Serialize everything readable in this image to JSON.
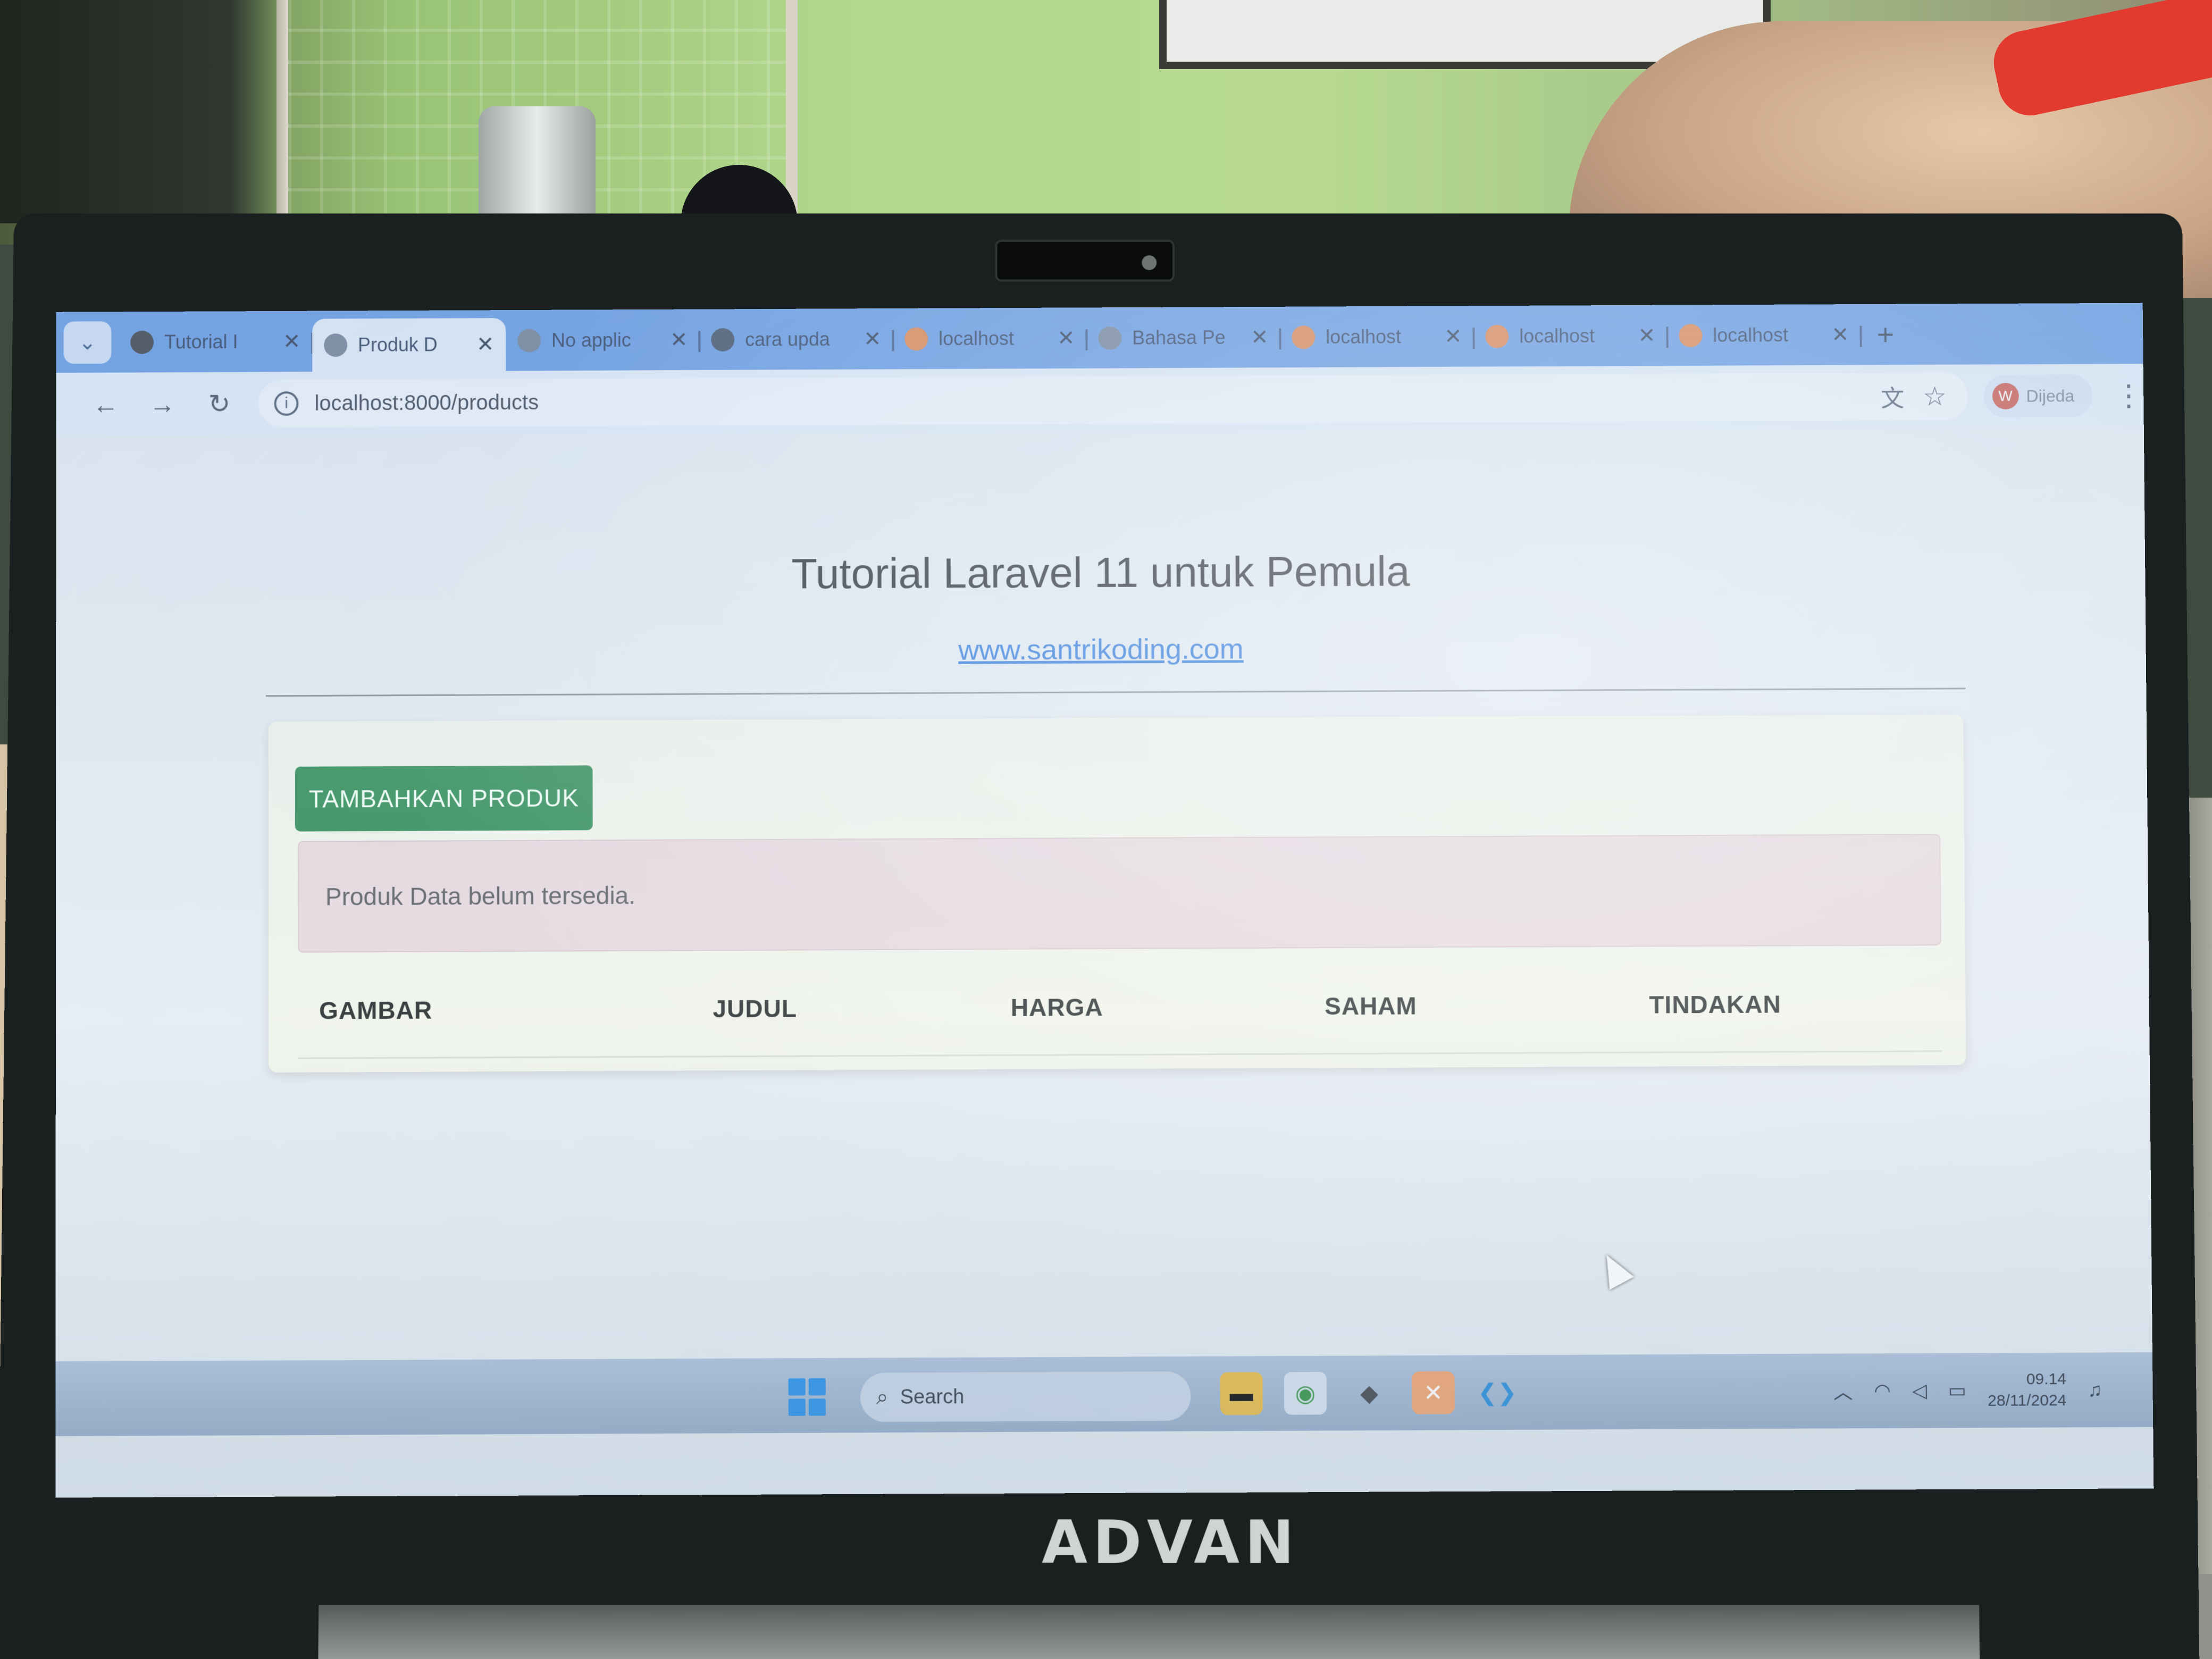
{
  "browser": {
    "tabs": [
      {
        "title": "Tutorial I",
        "icon": "github-icon",
        "active": false
      },
      {
        "title": "Produk D",
        "icon": "globe-icon",
        "active": true
      },
      {
        "title": "No applic",
        "icon": "globe-icon",
        "active": false
      },
      {
        "title": "cara upda",
        "icon": "avatar-icon",
        "active": false
      },
      {
        "title": "localhost",
        "icon": "phpmyadmin-icon",
        "active": false
      },
      {
        "title": "Bahasa Pe",
        "icon": "globe-icon",
        "active": false
      },
      {
        "title": "localhost",
        "icon": "phpmyadmin-icon",
        "active": false
      },
      {
        "title": "localhost",
        "icon": "phpmyadmin-icon",
        "active": false
      },
      {
        "title": "localhost",
        "icon": "phpmyadmin-icon",
        "active": false
      }
    ],
    "new_tab_symbol": "+",
    "close_symbol": "✕",
    "address": "localhost:8000/products",
    "profile_initial": "W",
    "profile_name": "Dijeda"
  },
  "page": {
    "title": "Tutorial Laravel 11 untuk Pemula",
    "link": "www.santrikoding.com",
    "add_button": "TAMBAHKAN PRODUK",
    "alert": "Produk Data belum tersedia.",
    "table_headers": [
      "GAMBAR",
      "JUDUL",
      "HARGA",
      "SAHAM",
      "TINDAKAN"
    ]
  },
  "taskbar": {
    "search_label": "Search",
    "time": "09.14",
    "date": "28/11/2024"
  },
  "device": {
    "brand": "ADVAN"
  },
  "colors": {
    "tabstrip": "#4f8be0",
    "button_green": "#2a8a53",
    "alert_bg": "#e5d8dd",
    "link_blue": "#1e6fd8"
  }
}
